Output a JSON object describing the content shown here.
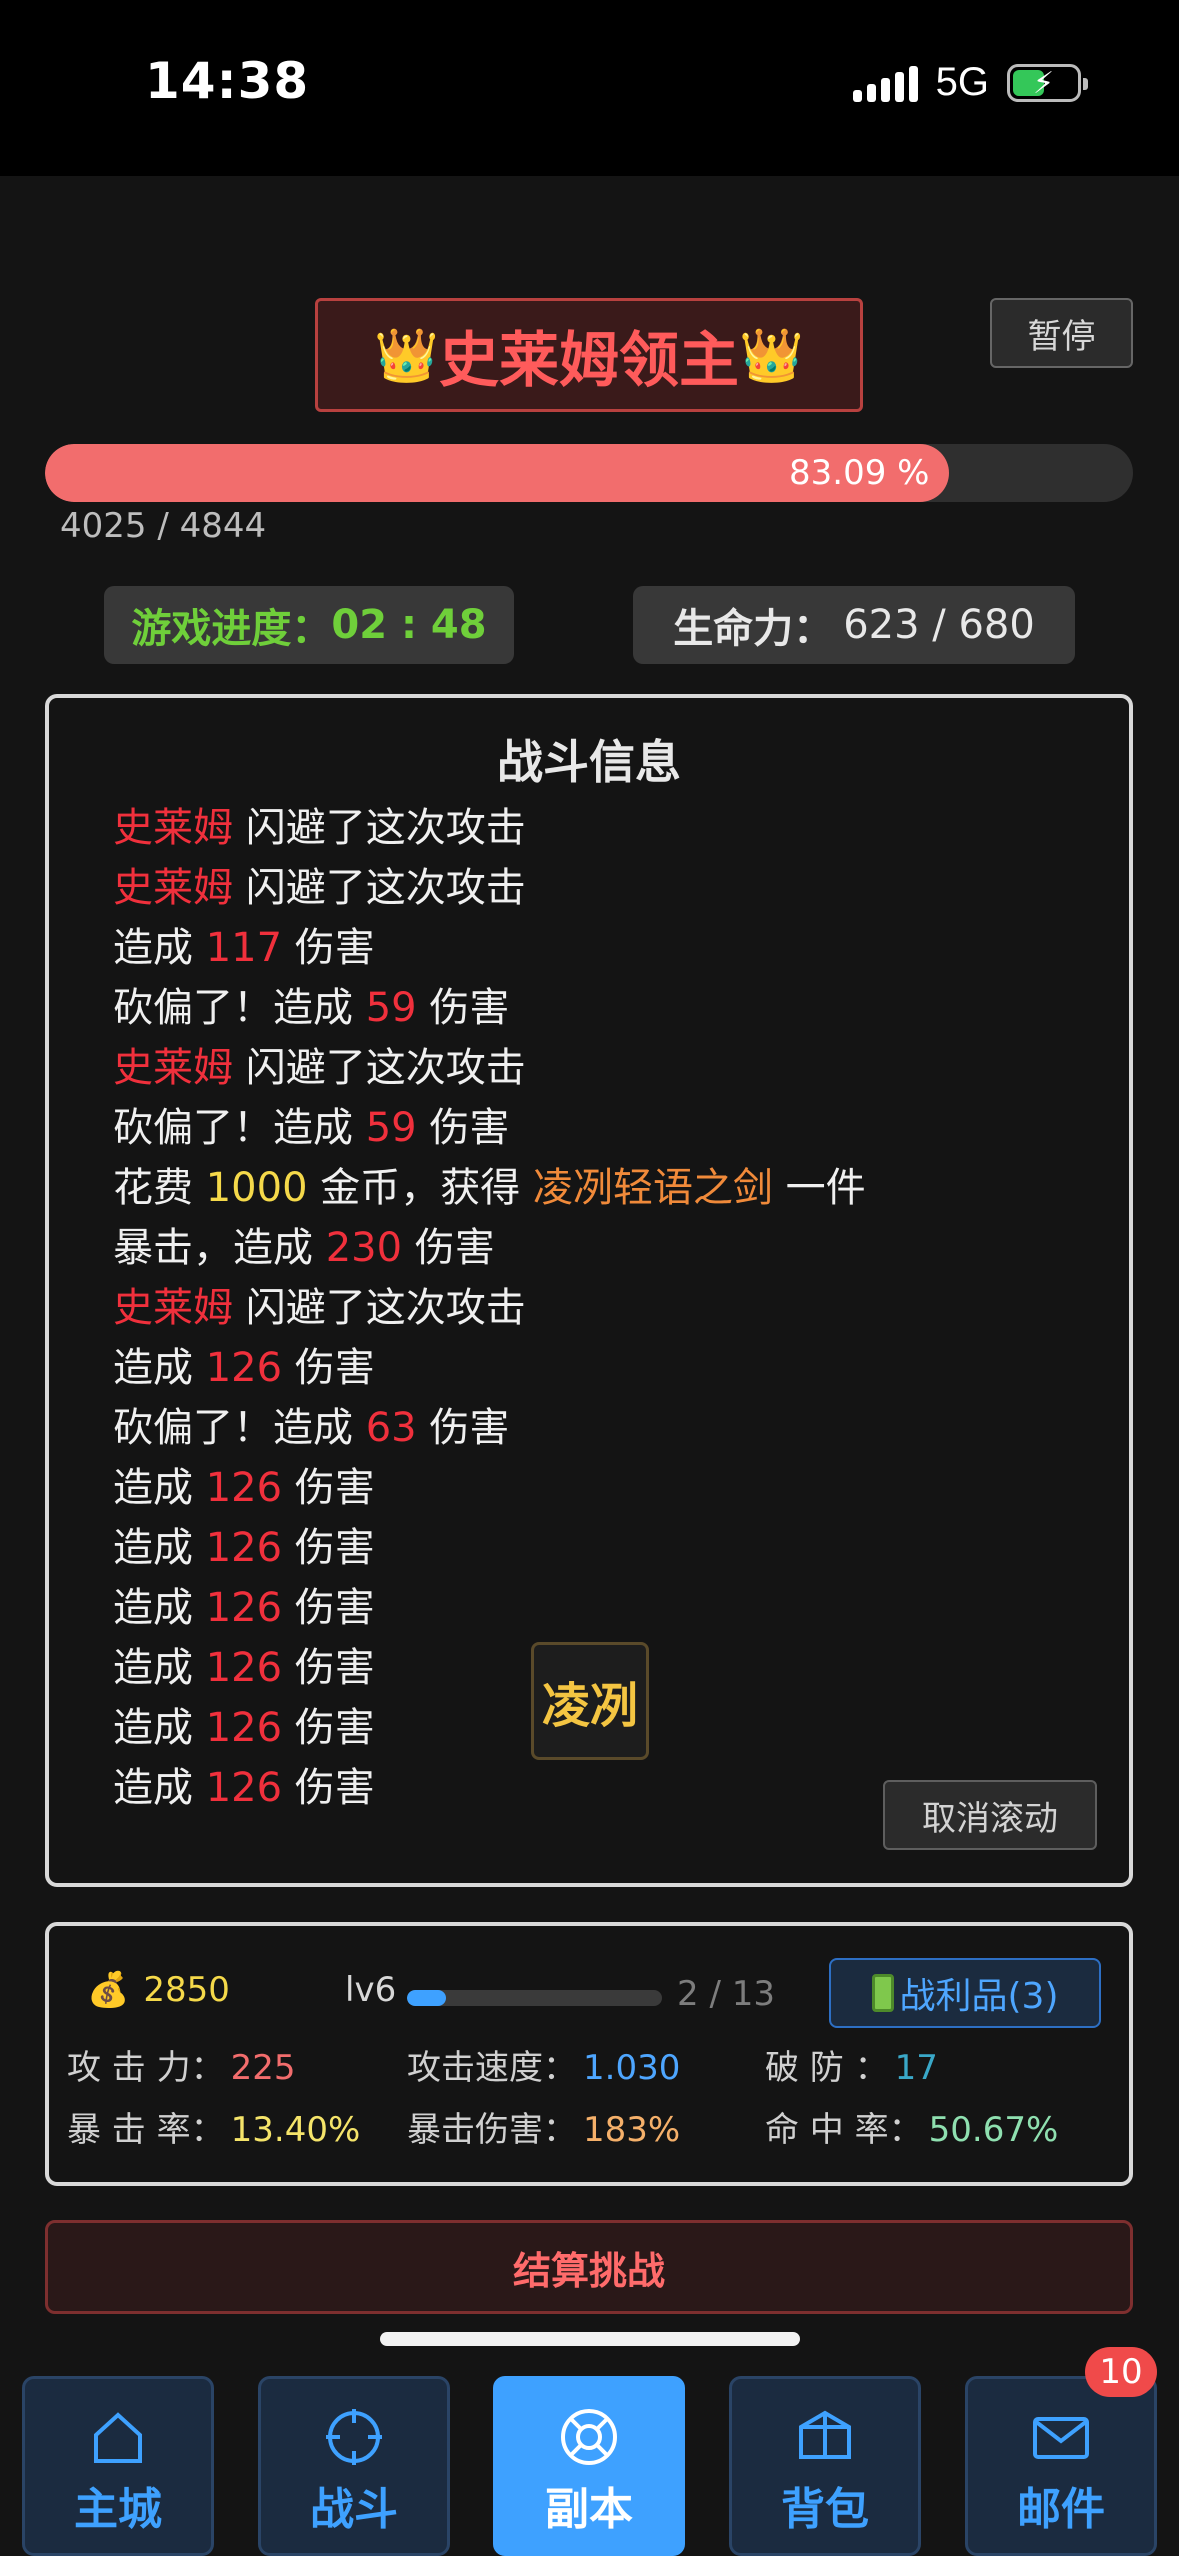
{
  "status_bar": {
    "time": "14:38",
    "network": "5G",
    "battery_level": 0.5
  },
  "boss": {
    "crown_left": "👑",
    "name": "史莱姆领主",
    "crown_right": "👑",
    "hp_current_text": "4025 / 4844",
    "hp_percent_text": "83.09 %",
    "hp_fraction": 0.8309
  },
  "pause_label": "暂停",
  "game_progress": {
    "label": "游戏进度：",
    "value": "02 : 48"
  },
  "vitality": {
    "label": "生命力：",
    "value": "623 / 680"
  },
  "battle": {
    "title": "战斗信息",
    "log": [
      [
        {
          "t": "史莱姆",
          "c": "red"
        },
        {
          "t": " 闪避了这次攻击"
        }
      ],
      [
        {
          "t": "史莱姆",
          "c": "red"
        },
        {
          "t": " 闪避了这次攻击"
        }
      ],
      [
        {
          "t": "造成 "
        },
        {
          "t": "117",
          "c": "red"
        },
        {
          "t": " 伤害"
        }
      ],
      [
        {
          "t": "砍偏了！造成 "
        },
        {
          "t": "59",
          "c": "red"
        },
        {
          "t": " 伤害"
        }
      ],
      [
        {
          "t": "史莱姆",
          "c": "red"
        },
        {
          "t": " 闪避了这次攻击"
        }
      ],
      [
        {
          "t": "砍偏了！造成 "
        },
        {
          "t": "59",
          "c": "red"
        },
        {
          "t": " 伤害"
        }
      ],
      [
        {
          "t": "花费 "
        },
        {
          "t": "1000",
          "c": "yellow"
        },
        {
          "t": " 金币，获得 "
        },
        {
          "t": "凌冽轻语之剑",
          "c": "orange"
        },
        {
          "t": " 一件"
        }
      ],
      [
        {
          "t": "暴击，造成 "
        },
        {
          "t": "230",
          "c": "red"
        },
        {
          "t": " 伤害"
        }
      ],
      [
        {
          "t": "史莱姆",
          "c": "red"
        },
        {
          "t": " 闪避了这次攻击"
        }
      ],
      [
        {
          "t": "造成 "
        },
        {
          "t": "126",
          "c": "red"
        },
        {
          "t": " 伤害"
        }
      ],
      [
        {
          "t": "砍偏了！造成 "
        },
        {
          "t": "63",
          "c": "red"
        },
        {
          "t": " 伤害"
        }
      ],
      [
        {
          "t": "造成 "
        },
        {
          "t": "126",
          "c": "red"
        },
        {
          "t": " 伤害"
        }
      ],
      [
        {
          "t": "造成 "
        },
        {
          "t": "126",
          "c": "red"
        },
        {
          "t": " 伤害"
        }
      ],
      [
        {
          "t": "造成 "
        },
        {
          "t": "126",
          "c": "red"
        },
        {
          "t": " 伤害"
        }
      ],
      [
        {
          "t": "造成 "
        },
        {
          "t": "126",
          "c": "red"
        },
        {
          "t": " 伤害"
        }
      ],
      [
        {
          "t": "造成 "
        },
        {
          "t": "126",
          "c": "red"
        },
        {
          "t": " 伤害"
        }
      ],
      [
        {
          "t": "造成 "
        },
        {
          "t": "126",
          "c": "red"
        },
        {
          "t": " 伤害"
        }
      ]
    ],
    "skill_icon_label": "凌冽",
    "cancel_scroll_label": "取消滚动"
  },
  "stats": {
    "gold": "2850",
    "level": "lv6",
    "xp_text": "2 / 13",
    "xp_fraction": 0.1538,
    "loot_label": "战利品(3)",
    "attack_label": "攻 击 力：",
    "attack_value": "225",
    "attack_speed_label": "攻击速度：",
    "attack_speed_value": "1.030",
    "armor_pen_label": "破    防  ：",
    "armor_pen_value": "17",
    "crit_rate_label": "暴 击 率：",
    "crit_rate_value": "13.40%",
    "crit_damage_label": "暴击伤害：",
    "crit_damage_value": "183%",
    "hit_rate_label": "命 中 率：",
    "hit_rate_value": "50.67%"
  },
  "settle_label": "结算挑战",
  "nav": {
    "items": [
      {
        "label": "主城",
        "icon": "home-icon"
      },
      {
        "label": "战斗",
        "icon": "crosshair-icon"
      },
      {
        "label": "副本",
        "icon": "lifebuoy-icon"
      },
      {
        "label": "背包",
        "icon": "package-icon"
      },
      {
        "label": "邮件",
        "icon": "mail-icon"
      }
    ],
    "active_index": 2,
    "mail_badge": "10"
  }
}
